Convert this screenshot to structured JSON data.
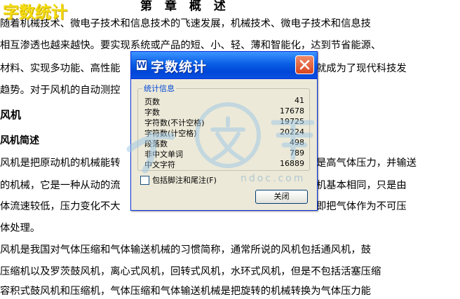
{
  "document": {
    "chapter_heading": "第 章 概 述",
    "overlay_title": "字数统计",
    "lines": [
      "随着机械技术、微电子技术和信息技术的飞速发展，机械技术、微电子技术和信息技",
      "相互渗透也越来越快。要实现系统或产品的短、小、轻、薄和智能化，达到节省能源、",
      "材料、实现多功能、高性能",
      "就成为了现代科技发",
      "趋势。对于风机的自动测控"
    ],
    "section_heading": "风机",
    "subsection_heading": "风机简述",
    "body_left": [
      "风机是把原动机的机械能转",
      "的机械，它是一种从动的流",
      "体流速较低，压力变化不大",
      "体处理。"
    ],
    "body_right": [
      "是高气体压力，并输送",
      "机基本相同，只是由",
      "即把气体作为不可压"
    ],
    "lines_bottom": [
      "风机是我国对气体压缩和气体输送机械的习惯简称，通常所说的风机包括通风机，鼓",
      "压缩机以及罗茨鼓风机，离心式风机，回转式风机，水环式风机，但是不包括活塞压缩",
      "容积式鼓风机和压缩机，气体压缩和气体输送机械是把旋转的机械转换为气体压力能"
    ]
  },
  "dialog": {
    "title": "字数统计",
    "app_icon": "word-app-icon",
    "close_icon": "close-icon",
    "group_label": "统计信息",
    "stats": [
      {
        "label": "页数",
        "value": "41"
      },
      {
        "label": "字数",
        "value": "17678"
      },
      {
        "label": "字符数(不计空格)",
        "value": "19725"
      },
      {
        "label": "字符数(计空格)",
        "value": "20224"
      },
      {
        "label": "段落数",
        "value": "498"
      },
      {
        "label": "非中文单词",
        "value": "789"
      },
      {
        "label": "中文字符",
        "value": "16889"
      }
    ],
    "checkbox_label": "包括脚注和尾注(F)",
    "checkbox_checked": false,
    "close_button_label": "关闭"
  },
  "watermark": {
    "text": "ndoc.com"
  },
  "colors": {
    "titlebar": "#0a5fe6",
    "dialog_bg": "#ece9d8",
    "group_label": "#0046d5",
    "overlay_title": "#f3dc10",
    "close_button": "#d8451f"
  }
}
